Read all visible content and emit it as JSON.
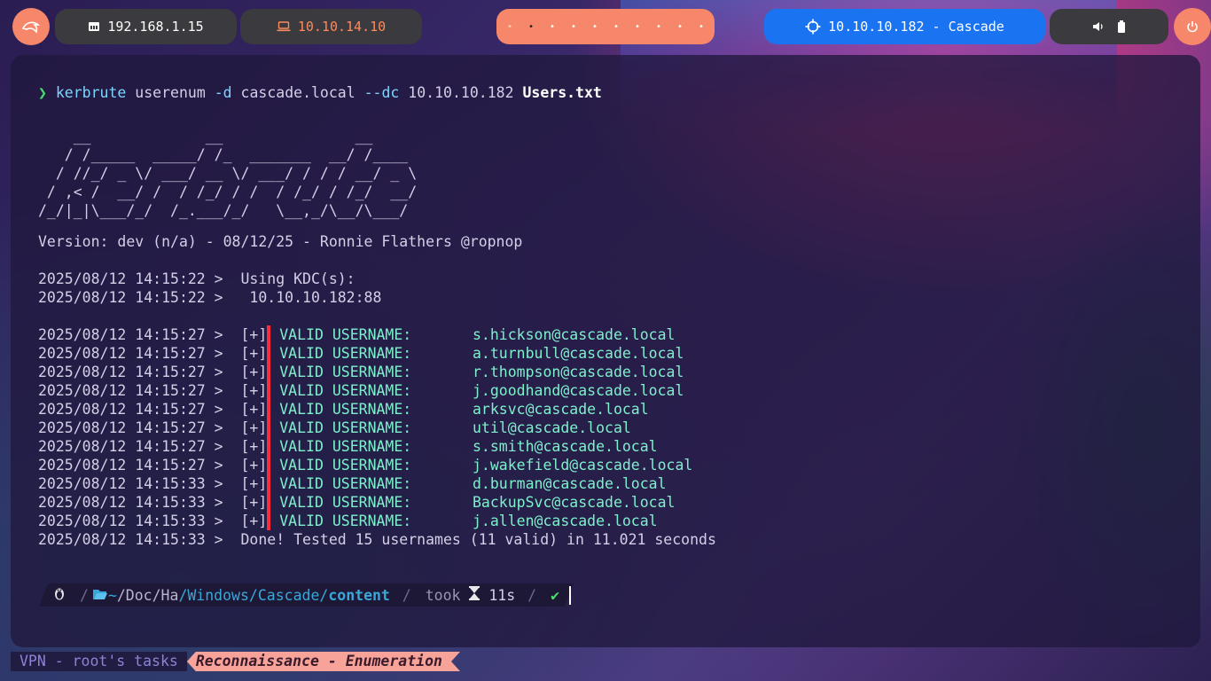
{
  "topbar": {
    "logo_icon": "kali-dragon-icon",
    "local_ip": "192.168.1.15",
    "local_ip_icon": "ethernet-icon",
    "vpn_ip": "10.10.14.10",
    "vpn_ip_icon": "laptop-icon",
    "workspaces": [
      "•",
      "•",
      "•",
      "•",
      "•",
      "•",
      "•",
      "•",
      "•",
      "•"
    ],
    "target_icon": "crosshair-icon",
    "target": "10.10.10.182 - Cascade",
    "volume_icon": "volume-icon",
    "battery_icon": "battery-icon",
    "power_icon": "power-icon",
    "colors": {
      "accent": "#f7876a",
      "target_bg": "#1a73f0",
      "pill_bg": "#3a3a3f",
      "vpn_ip": "#ff8a5c"
    }
  },
  "terminal": {
    "command": {
      "prompt_symbol": "❯",
      "program": "kerbrute",
      "subcommand": "userenum",
      "flag_d": "-d",
      "domain": "cascade.local",
      "flag_dc": "--dc",
      "dc": "10.10.10.182",
      "userfile": "Users.txt"
    },
    "banner": [
      "    __             __               __",
      "   / /_____  _____/ /_  _______  __/ /____",
      "  / //_/ _ \\/ ___/ __ \\/ ___/ / / / __/ _ \\",
      " / ,< /  __/ /  / /_/ / /  / /_/ / /_/  __/",
      "/_/|_|\\___/_/  /_.___/_/   \\__,_/\\__/\\___/"
    ],
    "version_line": "Version: dev (n/a) - 08/12/25 - Ronnie Flathers @ropnop",
    "kdc_lines": [
      "2025/08/12 14:15:22 >  Using KDC(s):",
      "2025/08/12 14:15:22 >   10.10.10.182:88"
    ],
    "results": [
      {
        "ts": "2025/08/12 14:15:27 >  ",
        "tag": "[+]",
        "label": " VALID USERNAME:",
        "user": "s.hickson@cascade.local"
      },
      {
        "ts": "2025/08/12 14:15:27 >  ",
        "tag": "[+]",
        "label": " VALID USERNAME:",
        "user": "a.turnbull@cascade.local"
      },
      {
        "ts": "2025/08/12 14:15:27 >  ",
        "tag": "[+]",
        "label": " VALID USERNAME:",
        "user": "r.thompson@cascade.local"
      },
      {
        "ts": "2025/08/12 14:15:27 >  ",
        "tag": "[+]",
        "label": " VALID USERNAME:",
        "user": "j.goodhand@cascade.local"
      },
      {
        "ts": "2025/08/12 14:15:27 >  ",
        "tag": "[+]",
        "label": " VALID USERNAME:",
        "user": "arksvc@cascade.local"
      },
      {
        "ts": "2025/08/12 14:15:27 >  ",
        "tag": "[+]",
        "label": " VALID USERNAME:",
        "user": "util@cascade.local"
      },
      {
        "ts": "2025/08/12 14:15:27 >  ",
        "tag": "[+]",
        "label": " VALID USERNAME:",
        "user": "s.smith@cascade.local"
      },
      {
        "ts": "2025/08/12 14:15:27 >  ",
        "tag": "[+]",
        "label": " VALID USERNAME:",
        "user": "j.wakefield@cascade.local"
      },
      {
        "ts": "2025/08/12 14:15:33 >  ",
        "tag": "[+]",
        "label": " VALID USERNAME:",
        "user": "d.burman@cascade.local"
      },
      {
        "ts": "2025/08/12 14:15:33 >  ",
        "tag": "[+]",
        "label": " VALID USERNAME:",
        "user": "BackupSvc@cascade.local"
      },
      {
        "ts": "2025/08/12 14:15:33 >  ",
        "tag": "[+]",
        "label": " VALID USERNAME:",
        "user": "j.allen@cascade.local"
      }
    ],
    "done_line": "2025/08/12 14:15:33 >  Done! Tested 15 usernames (11 valid) in 11.021 seconds"
  },
  "prompt": {
    "os_icon": "linux-penguin-icon",
    "folder_icon": "folder-open-icon",
    "path_home": "~",
    "path_doc": "/Doc",
    "path_ha": "/Ha",
    "path_windows": "/Windows",
    "path_cascade": "/Cascade/",
    "path_current": "content",
    "took_label": "took",
    "hourglass_icon": "hourglass-icon",
    "duration": "11s",
    "status_ok": "✔"
  },
  "statusline": {
    "left": "VPN - root's tasks",
    "right": "Reconnaissance - Enumeration"
  }
}
